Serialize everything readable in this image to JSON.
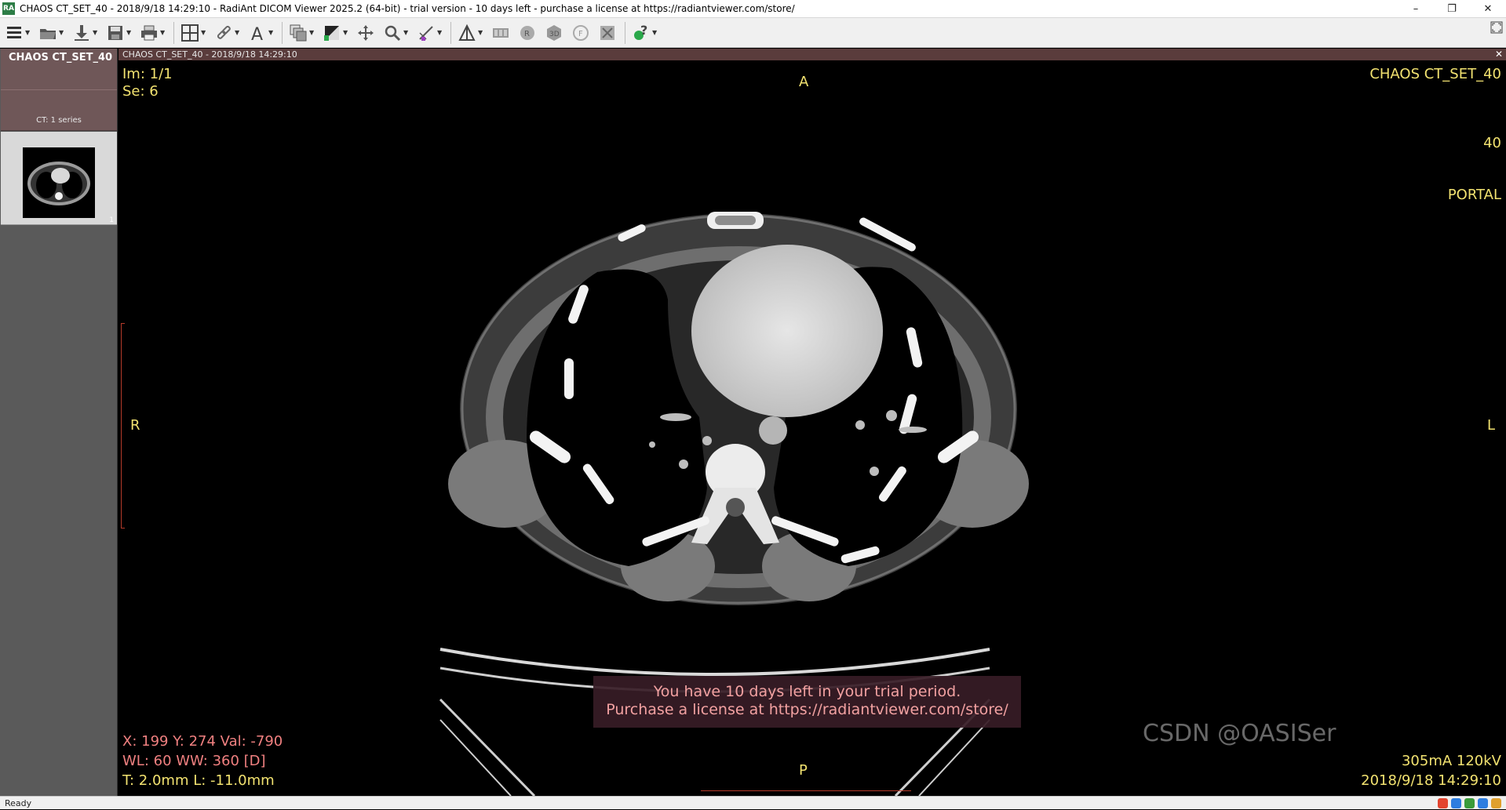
{
  "window": {
    "title": "CHAOS CT_SET_40 - 2018/9/18 14:29:10 - RadiAnt DICOM Viewer 2025.2 (64-bit) - trial version - 10 days left - purchase a license at https://radiantviewer.com/store/",
    "app_icon": "RA",
    "minimize": "–",
    "maximize": "❐",
    "close": "✕"
  },
  "toolbar": {
    "items": [
      {
        "icon": "menu-icon"
      },
      {
        "icon": "open-folder-icon"
      },
      {
        "icon": "import-icon"
      },
      {
        "icon": "save-icon"
      },
      {
        "icon": "print-icon"
      },
      {
        "icon": "layout-grid-icon"
      },
      {
        "icon": "link-icon"
      },
      {
        "icon": "annotation-text-icon"
      },
      {
        "icon": "series-icon"
      },
      {
        "icon": "window-level-icon"
      },
      {
        "icon": "pan-icon"
      },
      {
        "icon": "zoom-icon"
      },
      {
        "icon": "measure-icon"
      },
      {
        "icon": "mpr-icon"
      },
      {
        "icon": "3d-icon"
      },
      {
        "icon": "help-icon"
      }
    ]
  },
  "sidebar": {
    "study_name": "CHAOS CT_SET_40",
    "series_count": "CT: 1 series",
    "thumbnail_index": "1"
  },
  "viewer": {
    "header": "CHAOS CT_SET_40  - 2018/9/18 14:29:10",
    "close": "✕",
    "top_left": {
      "image": "Im: 1/1",
      "series": "Se: 6"
    },
    "top_right": {
      "name": "CHAOS CT_SET_40",
      "id": "40",
      "desc": "PORTAL"
    },
    "orientation": {
      "top": "A",
      "bottom": "P",
      "left": "R",
      "right": "L"
    },
    "bottom_left": {
      "coords": "X: 199 Y: 274 Val: -790",
      "window": "WL: 60 WW: 360 [D]",
      "thickness": "T: 2.0mm L: -11.0mm"
    },
    "bottom_right": {
      "exposure": "305mA 120kV",
      "datetime": "2018/9/18 14:29:10"
    },
    "trial_message": {
      "line1": "You have 10 days left in your trial period.",
      "line2": "Purchase a license at https://radiantviewer.com/store/"
    },
    "watermark": "CSDN @OASISer"
  },
  "status": {
    "text": "Ready"
  },
  "colors": {
    "overlay": "#f2e270",
    "overlay_red": "#f08080",
    "study_bg": "#6f5758"
  }
}
